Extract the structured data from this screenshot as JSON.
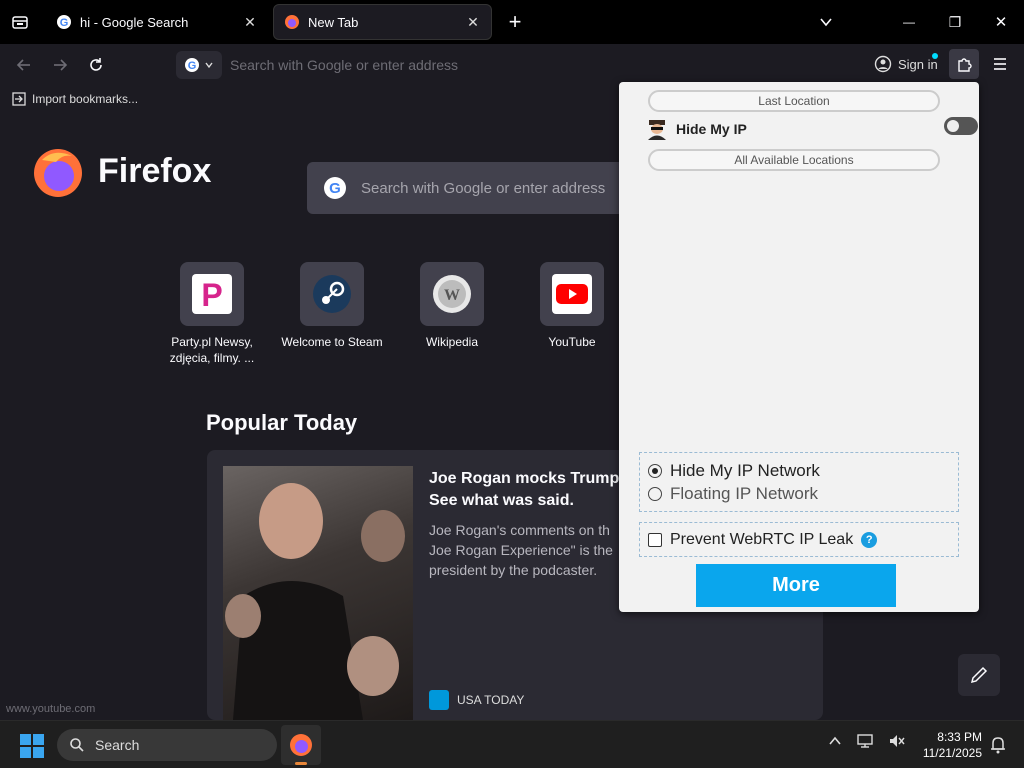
{
  "tabs": [
    {
      "title": "hi - Google Search",
      "close": "✕"
    },
    {
      "title": "New Tab",
      "close": "✕"
    }
  ],
  "newtab_icon": "+",
  "window_controls": {
    "minimize": "—",
    "maximize": "❐",
    "close": "✕"
  },
  "nav": {
    "url_placeholder": "Search with Google or enter address",
    "sign_in": "Sign in"
  },
  "bookmarks": {
    "import_label": "Import bookmarks..."
  },
  "home": {
    "brand": "Firefox",
    "search_placeholder": "Search with Google or enter address",
    "shortcuts": [
      {
        "label": "Party.pl Newsy, zdjęcia, filmy. ...",
        "icon": "party-pl-icon"
      },
      {
        "label": "Welcome to Steam",
        "icon": "steam-icon"
      },
      {
        "label": "Wikipedia",
        "icon": "wikipedia-icon"
      },
      {
        "label": "YouTube",
        "icon": "youtube-icon"
      }
    ],
    "popular_heading": "Popular Today",
    "story": {
      "title": "Joe Rogan mocks Trump See what was said.",
      "excerpt": "Joe Rogan's comments on th Joe Rogan Experience\" is the president by the podcaster.",
      "source": "USA TODAY"
    },
    "status_url": "www.youtube.com"
  },
  "popup": {
    "last_location": "Last Location",
    "hide_my_ip": "Hide My IP",
    "all_locations": "All Available Locations",
    "network_options": [
      {
        "label": "Hide My IP Network",
        "selected": true
      },
      {
        "label": "Floating IP Network",
        "selected": false
      }
    ],
    "webrtc_label": "Prevent WebRTC IP Leak",
    "help": "?",
    "more_button": "More"
  },
  "taskbar": {
    "search_label": "Search",
    "time": "8:33 PM",
    "date": "11/21/2025"
  },
  "colors": {
    "accent": "#0aa6ed",
    "content_bg": "#1c1b22",
    "tabstrip_bg": "#000000",
    "popup_bg": "#f2f2f2"
  }
}
